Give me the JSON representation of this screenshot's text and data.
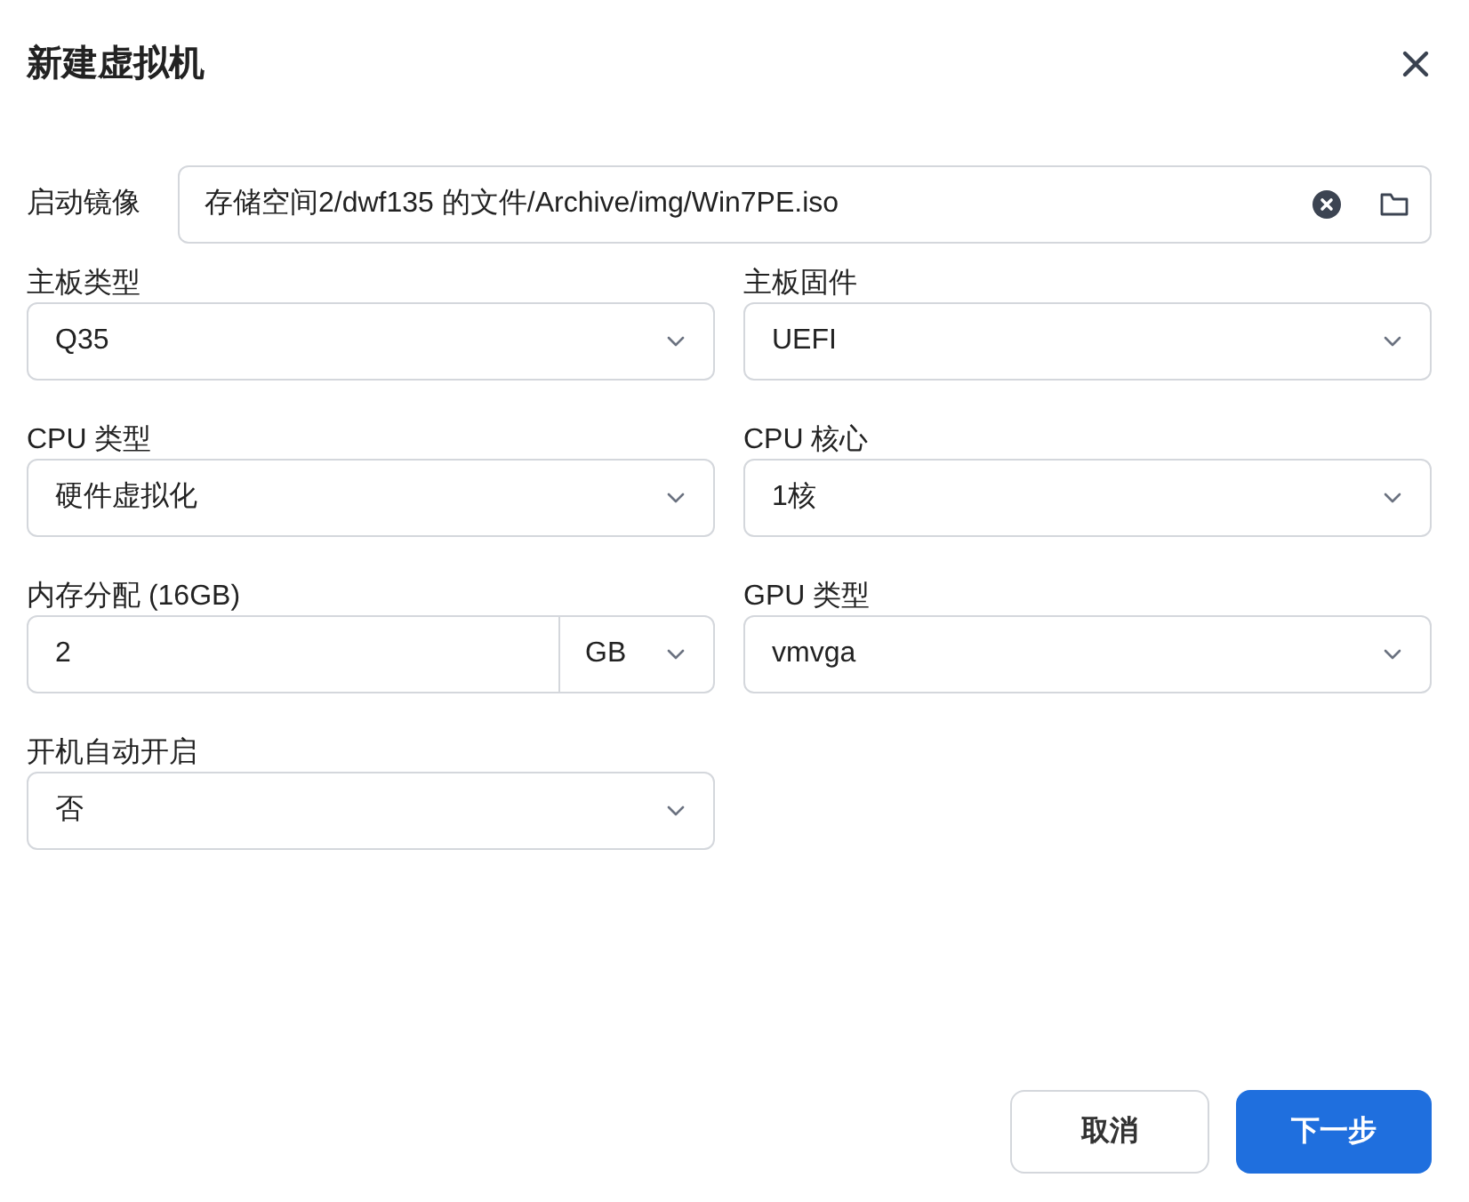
{
  "window": {
    "title": "新建虚拟机"
  },
  "boot_image": {
    "label": "启动镜像",
    "value": "存储空间2/dwf135 的文件/Archive/img/Win7PE.iso"
  },
  "fields": [
    {
      "kind": "select",
      "label": "主板类型",
      "value": "Q35"
    },
    {
      "kind": "select",
      "label": "主板固件",
      "value": "UEFI"
    },
    {
      "kind": "select",
      "label": "CPU 类型",
      "value": "硬件虚拟化"
    },
    {
      "kind": "select",
      "label": "CPU 核心",
      "value": "1核"
    },
    {
      "kind": "unit",
      "label": "内存分配 (16GB)",
      "value": "2",
      "unit": "GB"
    },
    {
      "kind": "select",
      "label": "GPU 类型",
      "value": "vmvga"
    },
    {
      "kind": "select",
      "label": "开机自动开启",
      "value": "否"
    }
  ],
  "buttons": [
    {
      "kind": "secondary",
      "label": "取消"
    },
    {
      "kind": "primary",
      "label": "下一步"
    }
  ]
}
